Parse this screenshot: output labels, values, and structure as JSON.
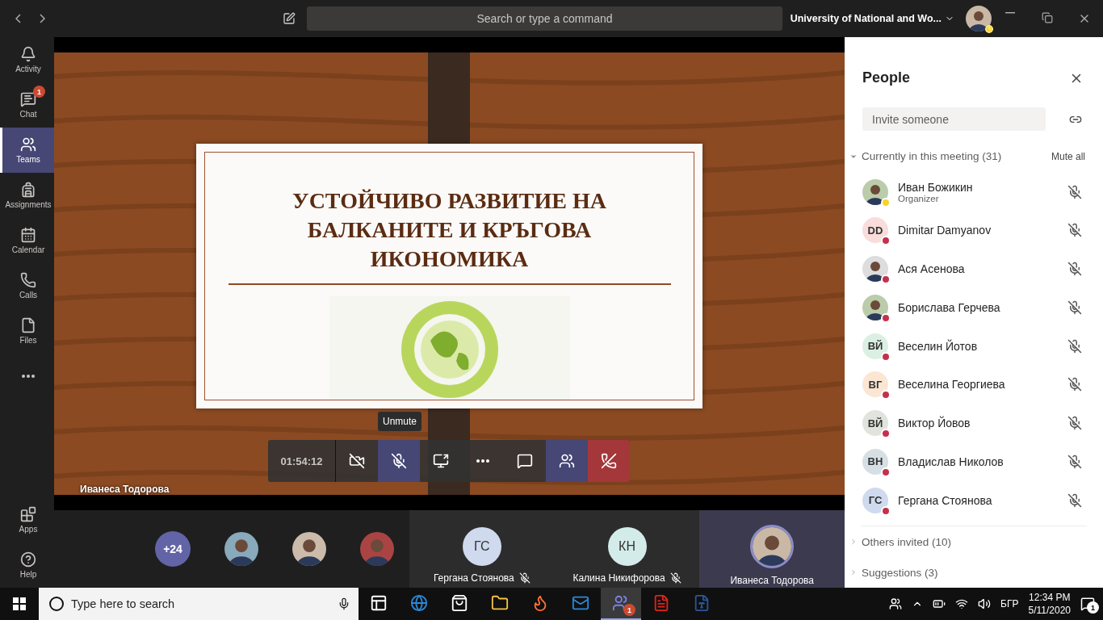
{
  "title_bar": {
    "search_placeholder": "Search or type a command",
    "organization": "University of National and Wo..."
  },
  "rail": [
    {
      "kind": "activity",
      "label": "Activity",
      "selected": false
    },
    {
      "kind": "chat",
      "label": "Chat",
      "selected": false,
      "badge": "1"
    },
    {
      "kind": "teams",
      "label": "Teams",
      "selected": true
    },
    {
      "kind": "assignments",
      "label": "Assignments",
      "selected": false
    },
    {
      "kind": "calendar",
      "label": "Calendar",
      "selected": false
    },
    {
      "kind": "calls",
      "label": "Calls",
      "selected": false
    },
    {
      "kind": "files",
      "label": "Files",
      "selected": false
    },
    {
      "kind": "more",
      "selected": false
    }
  ],
  "rail_bottom": [
    {
      "kind": "apps",
      "label": "Apps",
      "selected": false
    },
    {
      "kind": "help",
      "label": "Help",
      "selected": false
    }
  ],
  "stage": {
    "presenter": "Иванеса Тодорова",
    "slide_title": "УСТОЙЧИВО РАЗВИТИЕ НА БАЛКАНИТЕ И КРЪГОВА ИКОНОМИКА",
    "timer": "01:54:12",
    "tooltip": "Unmute",
    "controls": [
      {
        "kind": "camera",
        "selected": false
      },
      {
        "kind": "mic",
        "selected": true
      },
      {
        "kind": "share",
        "selected": false
      },
      {
        "kind": "more",
        "selected": false
      },
      {
        "kind": "chat",
        "selected": false
      },
      {
        "kind": "people",
        "selected": true
      },
      {
        "kind": "hangup",
        "selected": false
      }
    ]
  },
  "strip": {
    "overflow": "+24",
    "tiles": [
      {
        "initials": "ГС",
        "name": "Гергана Стоянова",
        "muted": true,
        "color": "#cfdaee",
        "self": false
      },
      {
        "initials": "КН",
        "name": "Калина Никифорова",
        "muted": true,
        "color": "#d3ece9",
        "self": false
      },
      {
        "name": "Иванеса Тодорова",
        "muted": false,
        "self": true
      }
    ]
  },
  "people": {
    "title": "People",
    "invite_placeholder": "Invite someone",
    "current": {
      "label": "Currently in this meeting (31)",
      "expanded": true,
      "action": "Mute all",
      "members": [
        {
          "name": "Иван Божикин",
          "role": "Organizer",
          "away": true,
          "muted": true
        },
        {
          "name": "Dimitar Damyanov",
          "initials": "DD",
          "color": "#f9dcdc",
          "kind": "initials",
          "away": false,
          "muted": true
        },
        {
          "name": "Ася Асенова",
          "away": false,
          "muted": true
        },
        {
          "name": "Борислава Герчева",
          "away": false,
          "muted": true
        },
        {
          "name": "Веселин Йотов",
          "initials": "ВЙ",
          "color": "#dcefe3",
          "kind": "initials",
          "away": false,
          "muted": true
        },
        {
          "name": "Веселина Георгиева",
          "initials": "ВГ",
          "color": "#fbe6d3",
          "kind": "initials",
          "away": false,
          "muted": true
        },
        {
          "name": "Виктор Йовов",
          "initials": "ВЙ",
          "color": "#e1e4dc",
          "kind": "initials",
          "away": false,
          "muted": true
        },
        {
          "name": "Владислав Николов",
          "initials": "ВН",
          "color": "#d6dfe4",
          "kind": "initials",
          "away": false,
          "muted": true
        },
        {
          "name": "Гергана Стоянова",
          "initials": "ГС",
          "color": "#cfdaee",
          "kind": "initials",
          "away": false,
          "muted": true
        }
      ]
    },
    "sections": [
      {
        "label": "Others invited (10)",
        "expanded": false
      },
      {
        "label": "Suggestions (3)",
        "expanded": false
      }
    ]
  },
  "taskbar": {
    "search_placeholder": "Type here to search",
    "apps": [
      {
        "kind": "taskview",
        "selected": false
      },
      {
        "kind": "edge",
        "selected": false
      },
      {
        "kind": "store",
        "selected": false
      },
      {
        "kind": "explorer",
        "selected": false
      },
      {
        "kind": "firefox",
        "selected": false
      },
      {
        "kind": "mail",
        "selected": false
      },
      {
        "kind": "teams",
        "selected": true,
        "badge": "1"
      },
      {
        "kind": "pdf",
        "selected": false
      },
      {
        "kind": "word",
        "selected": false
      }
    ],
    "language": "БГР",
    "time": "12:34 PM",
    "date": "5/11/2020",
    "notifications": "1"
  }
}
